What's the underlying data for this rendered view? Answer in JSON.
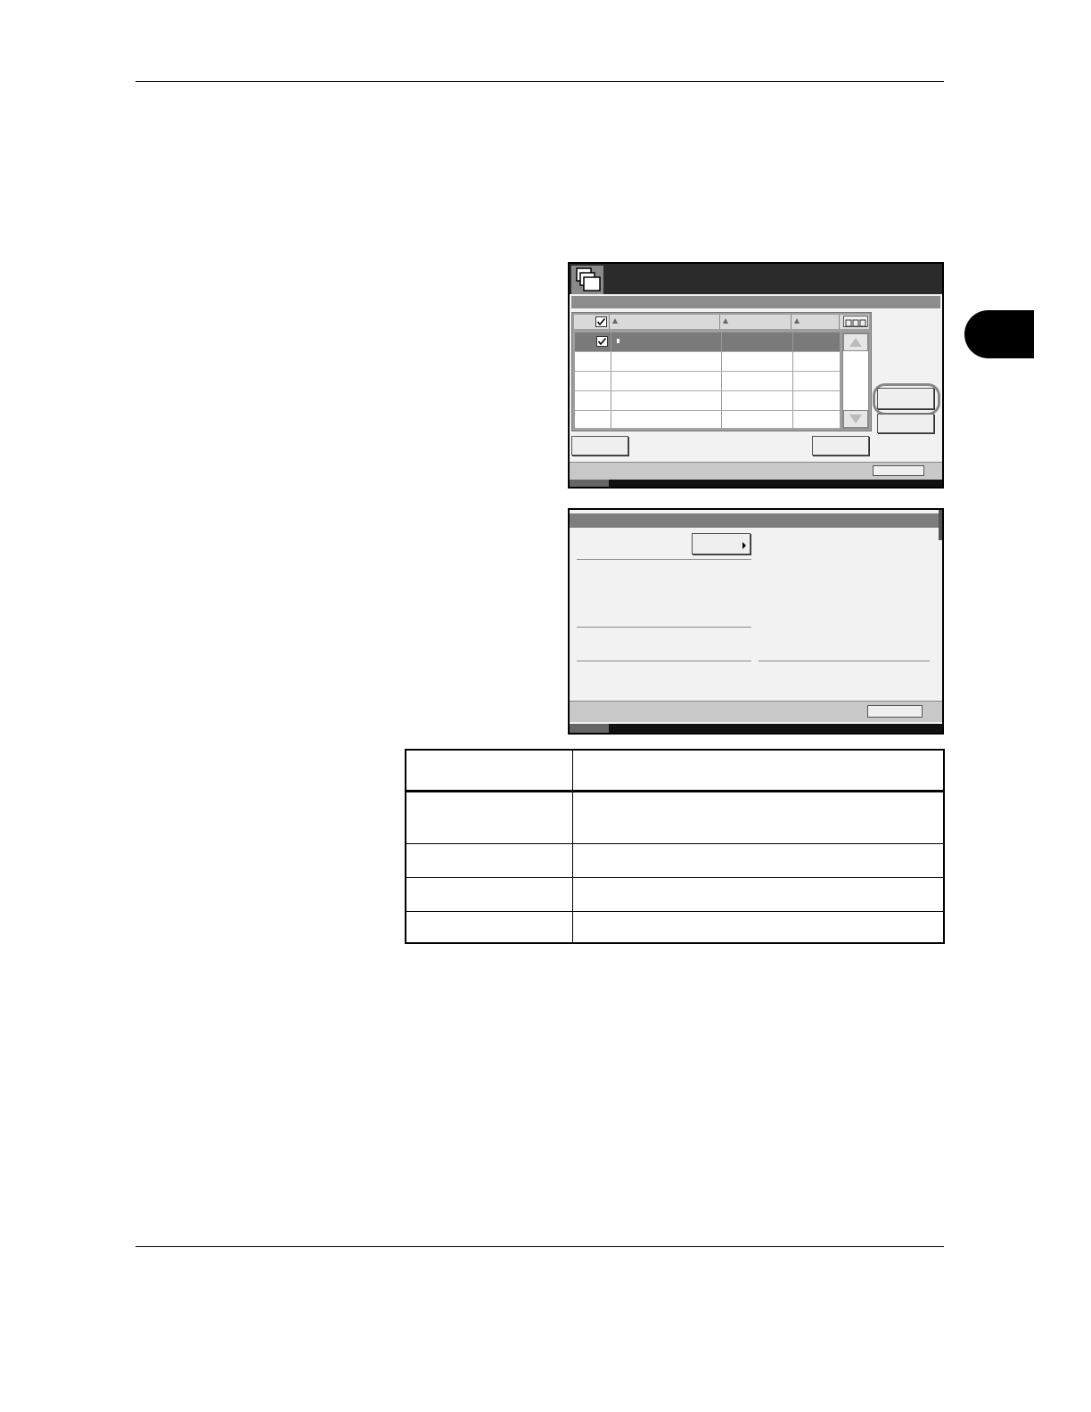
{
  "page": {
    "header_text": "",
    "body_text": "",
    "footer_text": ""
  },
  "screen1": {
    "title": "",
    "subtitle": "",
    "columns": [
      "",
      "",
      ""
    ],
    "rows": [
      {
        "name": "",
        "col2": "",
        "col3": "",
        "checked": true,
        "selected": true
      },
      {
        "name": "",
        "col2": "",
        "col3": "",
        "checked": false,
        "selected": false
      },
      {
        "name": "",
        "col2": "",
        "col3": "",
        "checked": false,
        "selected": false
      },
      {
        "name": "",
        "col2": "",
        "col3": "",
        "checked": false,
        "selected": false
      },
      {
        "name": "",
        "col2": "",
        "col3": "",
        "checked": false,
        "selected": false
      }
    ],
    "buttons": {
      "right_top": "",
      "right_bottom": "",
      "bottom_left": "",
      "bottom_right": "",
      "status_button": ""
    }
  },
  "screen2": {
    "title": "",
    "dropdown_value": "",
    "close_button": ""
  },
  "table": {
    "header": [
      "",
      ""
    ],
    "rows": [
      [
        "",
        ""
      ],
      [
        "",
        ""
      ],
      [
        "",
        ""
      ],
      [
        "",
        ""
      ]
    ]
  },
  "colors": {
    "title_bar": "#2b2b2b",
    "selected_row": "#7a7a7a",
    "chapter_tab": "#000000"
  }
}
